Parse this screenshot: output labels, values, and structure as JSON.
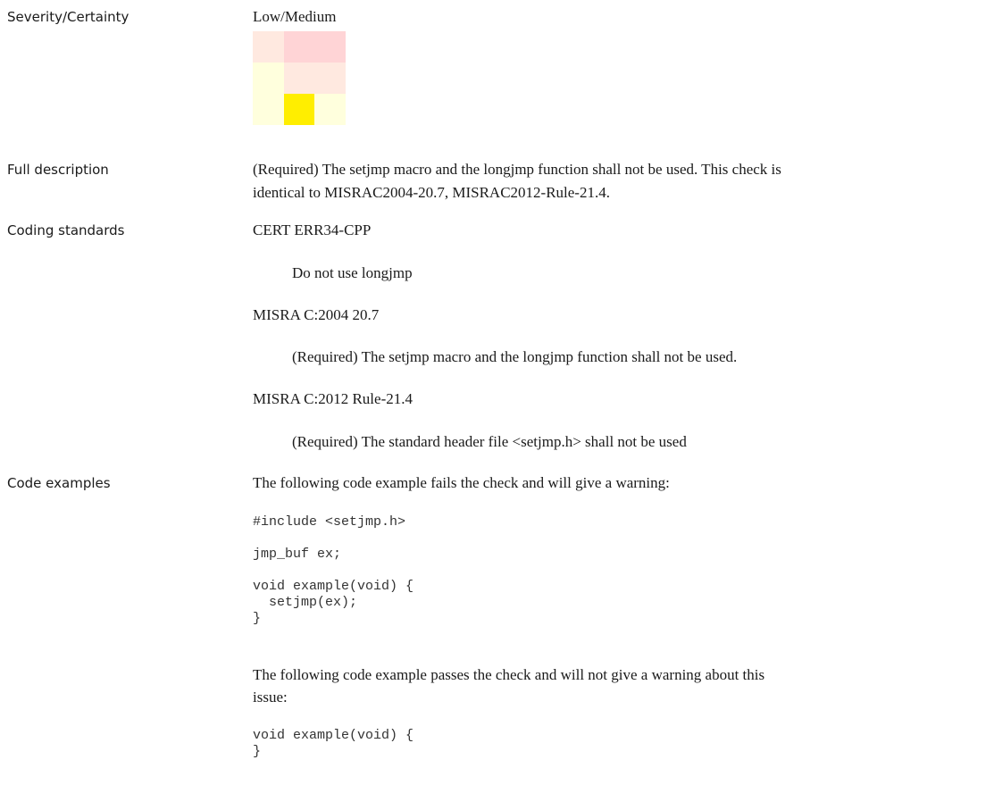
{
  "severity": {
    "label": "Severity/Certainty",
    "value": "Low/Medium"
  },
  "matrix": {
    "colors": [
      [
        "#ffe9e0",
        "#ffd4d6",
        "#ffd4d6"
      ],
      [
        "#ffffdd",
        "#ffe9e0",
        "#ffe9e0"
      ],
      [
        "#ffffdd",
        "#ffee00",
        "#ffffdd"
      ]
    ]
  },
  "description": {
    "label": "Full description",
    "line1": " (Required) The setjmp macro and the longjmp function shall not be used. This check is",
    "line2": "identical to MISRAC2004-20.7, MISRAC2012-Rule-21.4."
  },
  "standards": {
    "label": "Coding standards",
    "items": [
      {
        "name": "CERT ERR34-CPP",
        "text": "Do not use longjmp"
      },
      {
        "name": "MISRA C:2004 20.7",
        "text": "(Required) The setjmp macro and the longjmp function shall not be used."
      },
      {
        "name": "MISRA C:2012 Rule-21.4",
        "text": "(Required) The standard header file <setjmp.h> shall not be used"
      }
    ]
  },
  "examples": {
    "label": "Code examples",
    "fail_intro": "The following code example fails the check and will give a warning:",
    "fail_code": "#include <setjmp.h>\n\njmp_buf ex;\n\nvoid example(void) {\n  setjmp(ex);\n}",
    "pass_intro_line1": "The following code example passes the check and will not give a warning about this",
    "pass_intro_line2": "issue:",
    "pass_code": "void example(void) {\n}"
  }
}
